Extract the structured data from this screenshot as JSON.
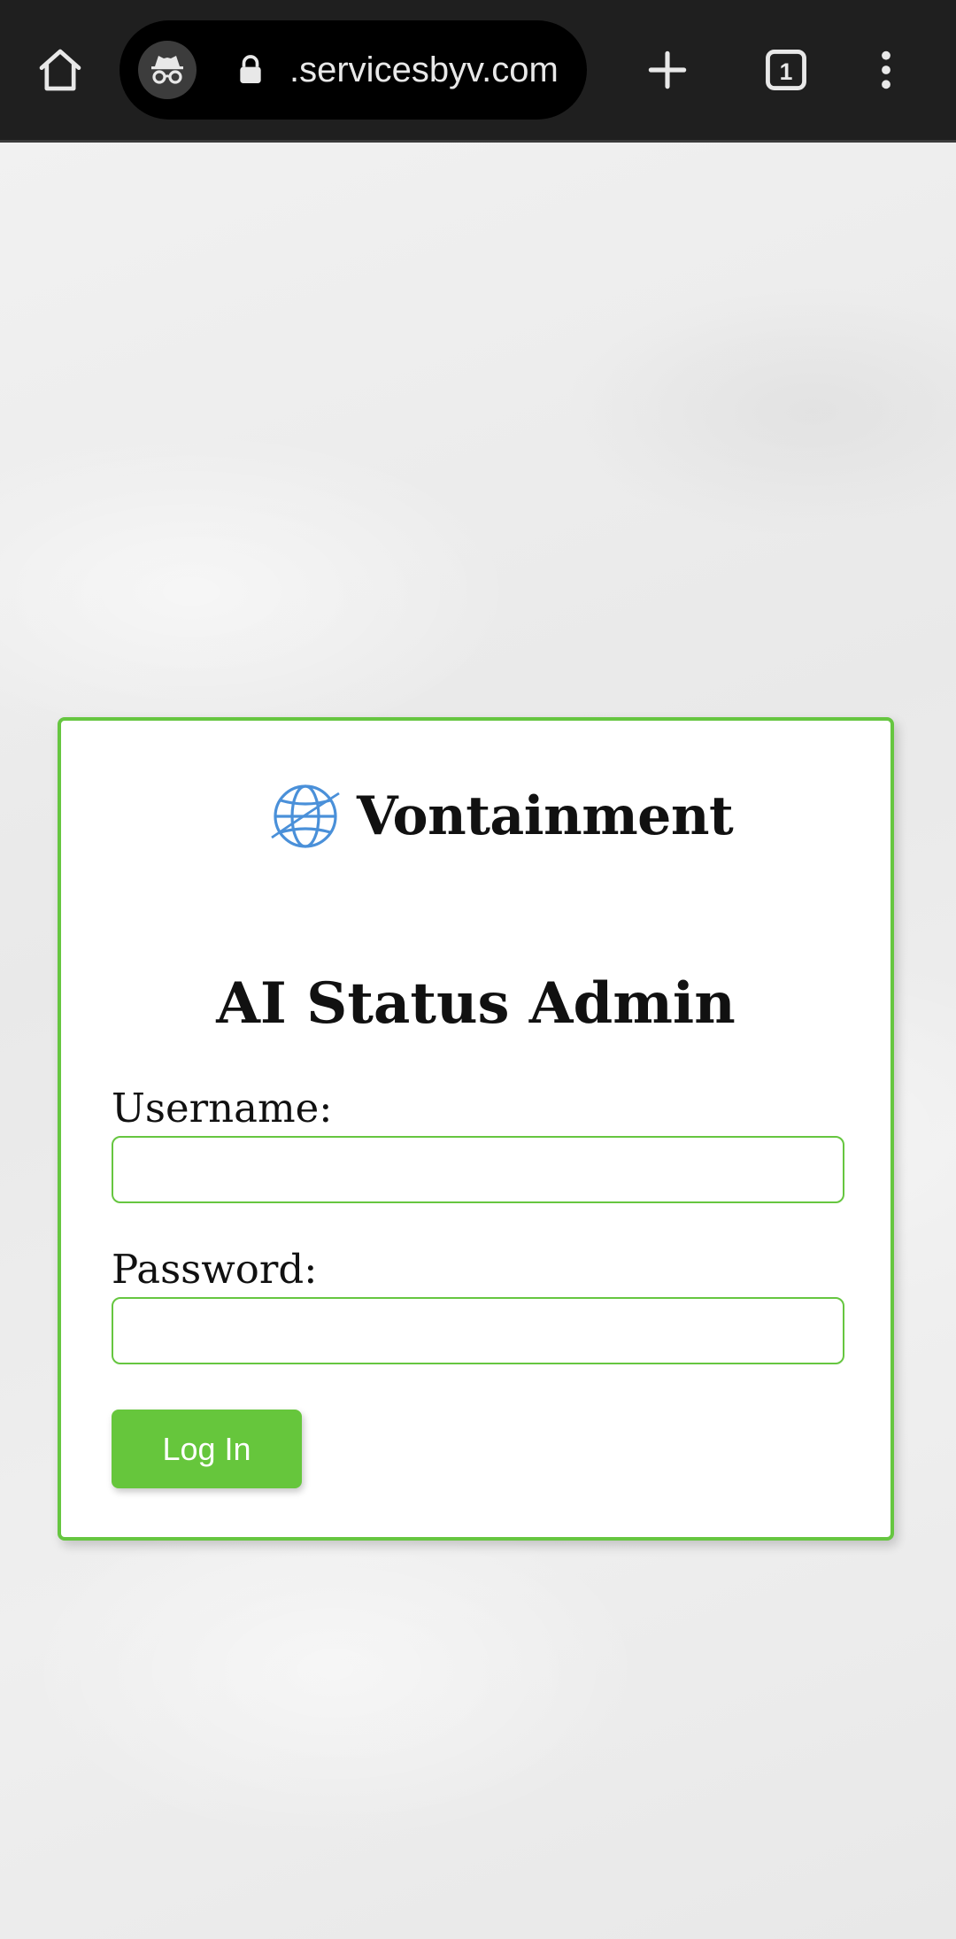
{
  "browser": {
    "url": ".servicesbyv.com",
    "tab_count": "1",
    "icons": {
      "home": "home-icon",
      "incognito": "incognito-icon",
      "lock": "lock-icon",
      "new_tab": "plus-icon",
      "tabs": "tab-switcher-icon",
      "menu": "more-vert-icon"
    }
  },
  "login": {
    "logo_text": "Vontainment",
    "title": "AI Status Admin",
    "username_label": "Username:",
    "username_value": "",
    "password_label": "Password:",
    "password_value": "",
    "submit_label": "Log In"
  },
  "colors": {
    "accent": "#66c640",
    "browser_bar": "#1f1f1f",
    "logo_globe": "#4a90d9"
  }
}
